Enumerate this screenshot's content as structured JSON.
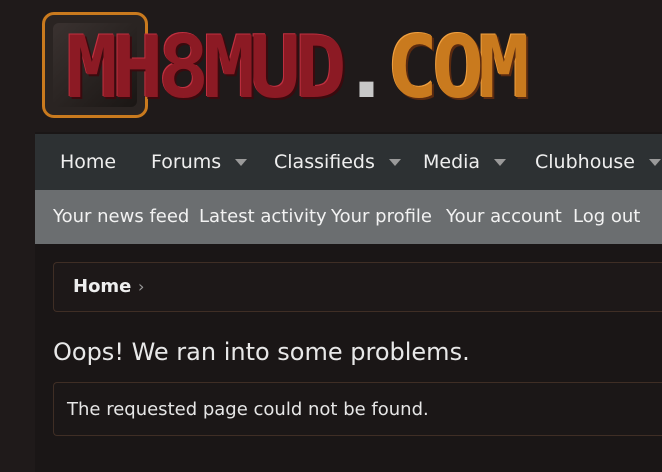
{
  "logo": {
    "prefix": "MH",
    "mid": "8MUD",
    "dot": ".",
    "suffix": "COM"
  },
  "nav": {
    "items": [
      {
        "label": "Home",
        "has_caret": false
      },
      {
        "label": "Forums",
        "has_caret": true
      },
      {
        "label": "Classifieds",
        "has_caret": true
      },
      {
        "label": "Media",
        "has_caret": true
      },
      {
        "label": "Clubhouse",
        "has_caret": true
      }
    ]
  },
  "subnav": {
    "items": [
      {
        "label": "Your news feed"
      },
      {
        "label": "Latest activity"
      },
      {
        "label": "Your profile"
      },
      {
        "label": "Your account"
      },
      {
        "label": "Log out"
      }
    ]
  },
  "breadcrumb": {
    "home": "Home",
    "separator": "›"
  },
  "error": {
    "title": "Oops! We ran into some problems.",
    "message": "The requested page could not be found."
  },
  "colors": {
    "accent": "#c97a1e",
    "brand_red": "#8c1a24",
    "nav_bg": "#2d3133",
    "subnav_bg": "#6b6e70",
    "page_bg": "#1f1a1a"
  }
}
